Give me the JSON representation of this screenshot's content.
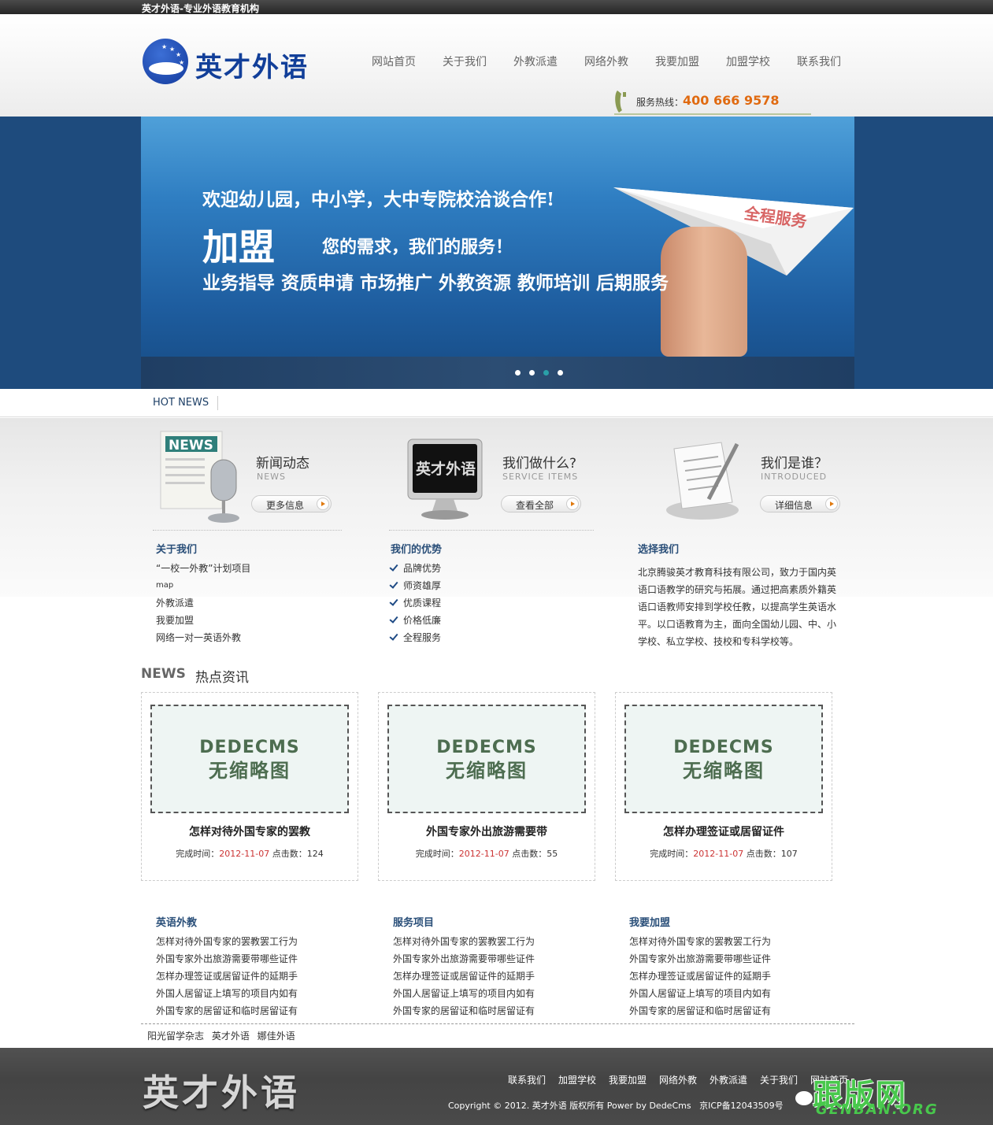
{
  "topbar": {
    "title": "英才外语-专业外语教育机构"
  },
  "header": {
    "logo_text": "英才外语",
    "nav": [
      "网站首页",
      "关于我们",
      "外教派遣",
      "网络外教",
      "我要加盟",
      "加盟学校",
      "联系我们"
    ],
    "hotline_label": "服务热线：",
    "hotline_number": "400 666 9578"
  },
  "banner": {
    "line1": "欢迎幼儿园，中小学，大中专院校洽谈合作!",
    "line2": "加盟",
    "line3": "您的需求，我们的服务！",
    "line4": "业务指导  资质申请  市场推广  外教资源  教师培训  后期服务",
    "plane_text": "全程服务",
    "active_slide": 3,
    "slides": 4
  },
  "hotnews": {
    "label": "HOT NEWS"
  },
  "features": [
    {
      "icon": "news-microphone-icon",
      "icon_text": "NEWS",
      "title": "新闻动态",
      "subtitle": "NEWS",
      "button": "更多信息"
    },
    {
      "icon": "monitor-icon",
      "icon_text": "英才外语",
      "title": "我们做什么?",
      "subtitle": "SERVICE ITEMS",
      "button": "查看全部"
    },
    {
      "icon": "document-pen-icon",
      "title": "我们是谁？",
      "subtitle": "INTRODUCED",
      "button": "详细信息"
    }
  ],
  "about": {
    "heading": "关于我们",
    "items": [
      "“一校一外教”计划项目",
      "map",
      "外教派遣",
      "我要加盟",
      "网络一对一英语外教"
    ]
  },
  "advantages": {
    "heading": "我们的优势",
    "items": [
      "品牌优势",
      "师资雄厚",
      "优质课程",
      "价格低廉",
      "全程服务"
    ]
  },
  "choose": {
    "heading": "选择我们",
    "text": "北京腾骏英才教育科技有限公司，致力于国内英语口语教学的研究与拓展。通过把高素质外籍英语口语教师安排到学校任教，以提高学生英语水平。以口语教育为主，面向全国幼儿园、中、小学校、私立学校、技校和专科学校等。"
  },
  "news": {
    "label_en": "NEWS",
    "label_cn": "热点资讯",
    "thumb_line1": "DEDECMS",
    "thumb_line2": "无缩略图",
    "time_label": "完成时间：",
    "clicks_label": "点击数：",
    "items": [
      {
        "title": "怎样对待外国专家的罢教",
        "date": "2012-11-07",
        "clicks": "124"
      },
      {
        "title": "外国专家外出旅游需要带",
        "date": "2012-11-07",
        "clicks": "55"
      },
      {
        "title": "怎样办理签证或居留证件",
        "date": "2012-11-07",
        "clicks": "107"
      }
    ]
  },
  "lists": [
    {
      "heading": "英语外教",
      "items": [
        "怎样对待外国专家的罢教罢工行为",
        "外国专家外出旅游需要带哪些证件",
        "怎样办理签证或居留证件的延期手",
        "外国人居留证上填写的项目内如有",
        "外国专家的居留证和临时居留证有"
      ]
    },
    {
      "heading": "服务项目",
      "items": [
        "怎样对待外国专家的罢教罢工行为",
        "外国专家外出旅游需要带哪些证件",
        "怎样办理签证或居留证件的延期手",
        "外国人居留证上填写的项目内如有",
        "外国专家的居留证和临时居留证有"
      ]
    },
    {
      "heading": "我要加盟",
      "items": [
        "怎样对待外国专家的罢教罢工行为",
        "外国专家外出旅游需要带哪些证件",
        "怎样办理签证或居留证件的延期手",
        "外国人居留证上填写的项目内如有",
        "外国专家的居留证和临时居留证有"
      ]
    }
  ],
  "friend_links": [
    "阳光留学杂志",
    "英才外语",
    "娜佳外语"
  ],
  "footer": {
    "logo_text": "英才外语",
    "nav": [
      "联系我们",
      "加盟学校",
      "我要加盟",
      "网络外教",
      "外教派遣",
      "关于我们",
      "网站首页"
    ],
    "copyright": "Copyright © 2012. 英才外语 版权所有 Power by DedeCms",
    "icp": "京ICP备12043509号",
    "watermark": "跟版网",
    "watermark_url": "GENBAN.ORG"
  }
}
